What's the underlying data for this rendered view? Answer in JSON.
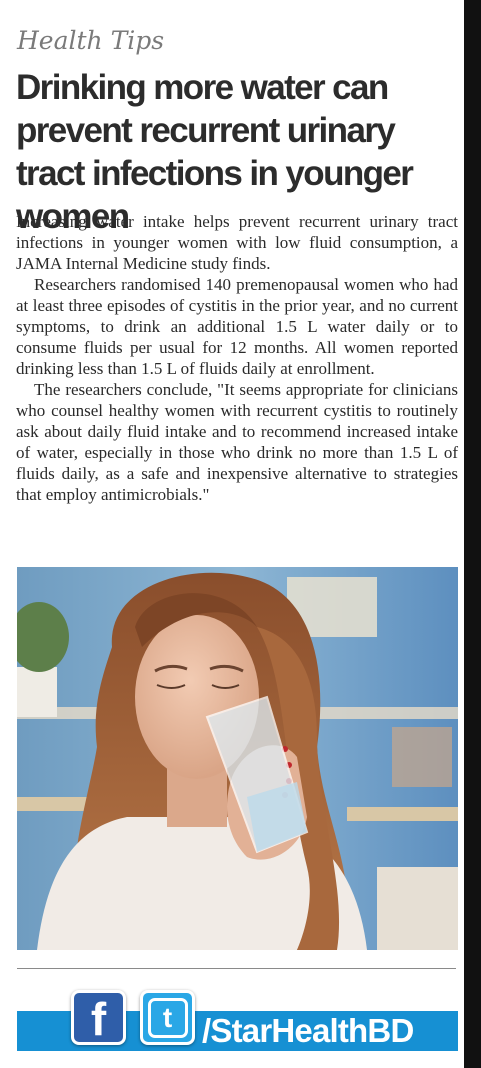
{
  "kicker": "Health Tips",
  "headline": "Drinking more water can prevent recurrent urinary tract infections in younger women",
  "body": {
    "p1": "Increasing water intake helps prevent recurrent urinary tract infections in younger women with low fluid consumption, a JAMA Internal Medicine study finds.",
    "p2": "Researchers randomised 140 premenopausal women who had at least three episodes of cystitis in the prior year, and no current symptoms, to drink an additional 1.5 L water daily or to consume fluids per usual for 12 months. All women reported drinking less than 1.5 L of fluids daily at enrollment.",
    "p3": "The researchers conclude, \"It seems appropriate for clinicians who counsel healthy women with recurrent cystitis to routinely ask about daily fluid intake and to recommend increased intake of water, especially in those who drink no more than 1.5 L of fluids daily, as a safe and inexpensive alternative to strategies that employ antimicrobials.\""
  },
  "social": {
    "facebook_icon": "facebook-icon",
    "twitter_icon": "twitter-icon",
    "facebook_glyph": "f",
    "twitter_glyph": "t",
    "handle": "/StarHealthBD",
    "bar_color": "#1690d3"
  }
}
